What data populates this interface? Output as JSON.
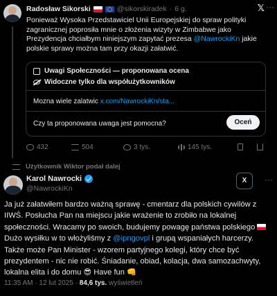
{
  "tweet1": {
    "author_name": "Radosław Sikorski",
    "handle": "@sikorskiradek",
    "time": "6 g.",
    "text_before": "Ponieważ Wysoka Przedstawiciel Unii Europejskiej do spraw polityki zagranicznej poprosiła mnie o złożenia wizyty w Zimbabwe jako Prezydencja chciałbym niniejszym zapytać prezesa ",
    "mention": "@NawrockiKn",
    "text_after": " jakie polskie sprawy można tam przy okazji załatwić.",
    "community_note": {
      "title": "Uwagi Społeczności — proponowana ocena",
      "subtitle": "Widoczne tylko dla współużytkowników",
      "text_prefix": "Mozna wiele zalatwic ",
      "link": "x.com/NawrockiKn/sta...",
      "question": "Czy ta proponowana uwaga jest pomocna?",
      "rate_button": "Oceń"
    },
    "actions": {
      "replies": "432",
      "reposts": "504",
      "likes": "3 tys.",
      "views": "145 tys."
    }
  },
  "repost_label": "Użytkownik Wiktor podał dalej",
  "tweet2": {
    "author_name": "Karol Nawrocki",
    "handle": "@NawrockiKn",
    "grok_label": "X",
    "text_part1": "Ja już załatwiłem bardzo ważną sprawę - cmentarz dla polskich cywilów z IIWŚ. Posłucha Pan na miejscu jakie wrażenie to zrobiło na lokalnej społeczności. Wracamy po swoich, budujemy powagę państwa polskiego ",
    "text_part2": " Dużo wysiłku w to włożyliśmy z ",
    "mention": "@ipngovpl",
    "text_part3": " i grupą wspaniałych harcerzy. Także może Pan Minister - wzorem partyjnego kolegi, który chce być prezydentem - nic nie robić. Śniadanie, obiad, kolacja, dwa samozachwyty, lokalna elita i do domu ",
    "emoji_cool": "😎",
    "text_part4": " Have fun ",
    "emoji_hand": "👊",
    "time": "11:35 AM · 12 lut 2025 · ",
    "views": "84,6 tys.",
    "views_label": " wyświetleń"
  },
  "colors": {
    "background": "#000000",
    "text": "#e7e9ea",
    "muted": "#71767b",
    "accent": "#1d9bf0",
    "border": "#2f3336"
  },
  "icons": [
    "x-logo-icon",
    "more-icon",
    "note-icon",
    "eye-off-icon",
    "reply-icon",
    "repost-icon",
    "like-icon",
    "views-icon",
    "bookmark-icon",
    "share-icon",
    "verified-icon"
  ]
}
